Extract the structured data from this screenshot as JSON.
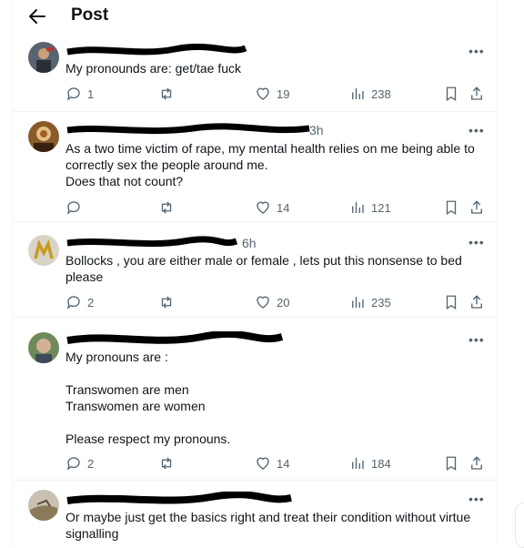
{
  "header": {
    "title": "Post"
  },
  "posts": [
    {
      "text": "My pronounds are: get/tae fuck",
      "time": "",
      "replies": "1",
      "retweets": "",
      "likes": "19",
      "views": "238"
    },
    {
      "text": "As a two time victim of rape, my mental health relies on me being able to correctly sex the people around me.\nDoes that not count?",
      "time": "3h",
      "replies": "",
      "retweets": "",
      "likes": "14",
      "views": "121"
    },
    {
      "text": "Bollocks , you are either male or female , lets put this nonsense to bed please",
      "time": "6h",
      "replies": "2",
      "retweets": "",
      "likes": "20",
      "views": "235"
    },
    {
      "text": "My pronouns are :\n\nTranswomen are men\nTranswomen are women\n\nPlease respect my pronouns.",
      "time": "",
      "replies": "2",
      "retweets": "",
      "likes": "14",
      "views": "184"
    },
    {
      "text": "Or maybe just get the basics right and treat their condition without virtue signalling",
      "time": "",
      "replies": "",
      "retweets": "",
      "likes": "",
      "views": ""
    }
  ],
  "more_label": "•••",
  "icons": {
    "back": "back-arrow-icon",
    "reply": "reply-icon",
    "retweet": "retweet-icon",
    "like": "heart-icon",
    "views": "views-icon",
    "bookmark": "bookmark-icon",
    "share": "share-icon"
  }
}
